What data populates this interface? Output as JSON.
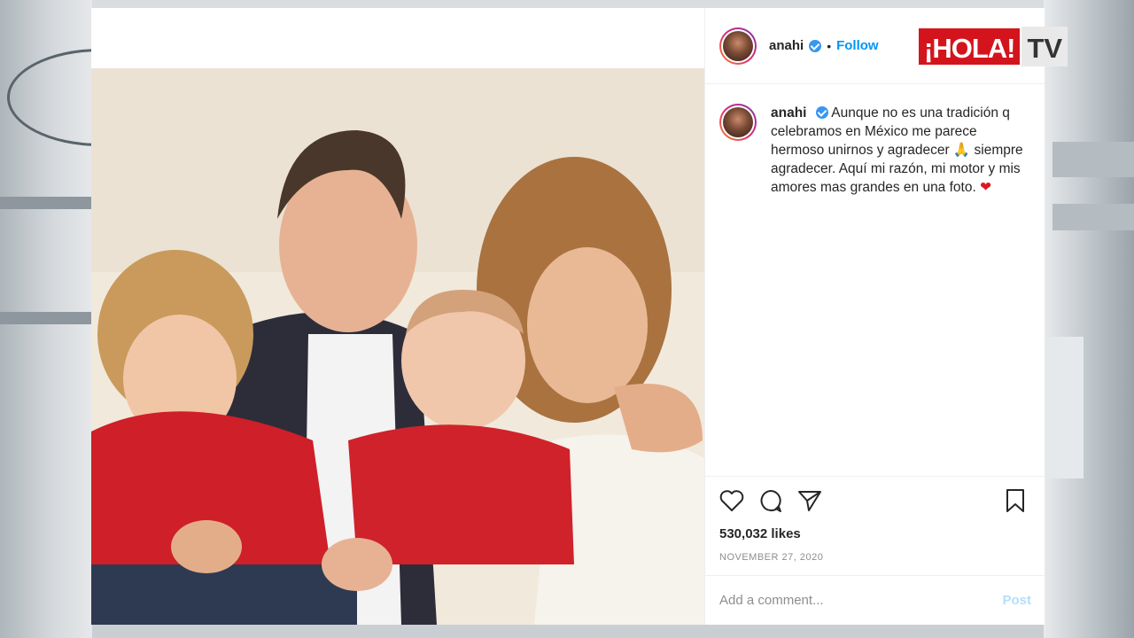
{
  "post": {
    "username": "anahi",
    "separator": "•",
    "follow_label": "Follow",
    "caption": "Aunque no es una tradición q celebramos en México me parece hermoso unirnos y agradecer",
    "caption_cont": "siempre agradecer. Aquí mi razón, mi motor y mis amores mas grandes en una foto.",
    "emoji_pray": "🙏",
    "emoji_heart": "❤",
    "likes": "530,032 likes",
    "date": "NOVEMBER 27, 2020",
    "comment_placeholder": "Add a comment...",
    "post_label": "Post"
  },
  "logo": {
    "brand": "¡HOLA!",
    "suffix": "TV"
  },
  "colors": {
    "accent": "#0095f6",
    "verified": "#3897f0",
    "brand_red": "#d4141c"
  },
  "icons": [
    "heart-icon",
    "comment-icon",
    "share-icon",
    "bookmark-icon",
    "verified-icon"
  ]
}
